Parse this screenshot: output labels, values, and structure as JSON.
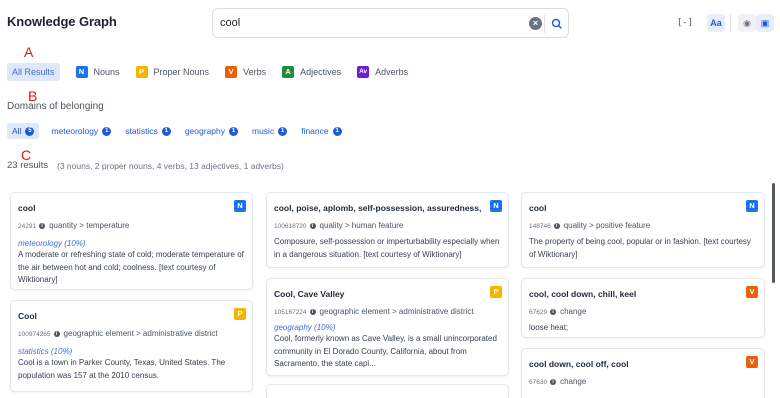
{
  "header": {
    "logo": "Knowledge Graph",
    "search_value": "cool",
    "clear_glyph": "×",
    "font_label": "Aa",
    "expand_glyph": "[-]",
    "settings_glyph": "◉",
    "chat_glyph": "▣"
  },
  "markers": {
    "a": "A",
    "b": "B",
    "c": "C"
  },
  "pos_filters": [
    {
      "label": "All Results"
    },
    {
      "badge": "N",
      "label": "Nouns",
      "color": "#1a73e8"
    },
    {
      "badge": "P",
      "label": "Proper Nouns",
      "color": "#f5b400"
    },
    {
      "badge": "V",
      "label": "Verbs",
      "color": "#e8620c"
    },
    {
      "badge": "A",
      "label": "Adjectives",
      "color": "#1e8e3e"
    },
    {
      "badge": "Av",
      "label": "Adverbs",
      "color": "#6a1fd6"
    }
  ],
  "domains": {
    "title": "Domains of belonging",
    "items": [
      {
        "label": "All",
        "count": "5"
      },
      {
        "label": "meteorology",
        "count": "1"
      },
      {
        "label": "statistics",
        "count": "1"
      },
      {
        "label": "geography",
        "count": "1"
      },
      {
        "label": "music",
        "count": "1"
      },
      {
        "label": "finance",
        "count": "1"
      }
    ]
  },
  "results": {
    "count": "23 results",
    "detail": "(3 nouns, 2 proper nouns, 4 verbs, 13 adjectives, 1 adverbs)"
  },
  "cards": [
    {
      "title": "cool",
      "badge": "N",
      "id": "24291",
      "category": "quantity > temperature",
      "domain": "meteorology (10%)",
      "definition": "A moderate or refreshing state of cold; moderate temperature of the air between hot and cold; coolness. [text courtesy of Wiktionary]"
    },
    {
      "title": "Cool",
      "badge": "P",
      "id": "100974265",
      "category": "geographic element > administrative district",
      "domain": "statistics (10%)",
      "definition": "Cool is a town in Parker County, Texas, United States. The population was 157 at the 2010 census."
    },
    {
      "title": "cool, poise, aplomb, self-possession, assuredness, sa...",
      "badge": "N",
      "id": "100618720",
      "category": "quality > human feature",
      "domain": "",
      "definition": "Composure, self-possession or imperturbability especially when in a dangerous situation. [text courtesy of Wiktionary]"
    },
    {
      "title": "Cool, Cave Valley",
      "badge": "P",
      "id": "105167224",
      "category": "geographic element > administrative district",
      "domain": "geography (10%)",
      "definition": "Cool, formerly known as Cave Valley, is a small unincorporated community in El Dorado County, California, about from Sacramento, the state capi..."
    },
    {
      "title": "cool",
      "badge": "N",
      "id": "148746",
      "category": "quality > positive feature",
      "domain": "",
      "definition": "The property of being cool, popular or in fashion. [text courtesy of Wiktionary]"
    },
    {
      "title": "cool, cool down, chill, keel",
      "badge": "V",
      "id": "67629",
      "category": "change",
      "domain": "",
      "definition": "loose heat;"
    },
    {
      "title": "cool down, cool off, cool",
      "badge": "V",
      "id": "67630",
      "category": "change",
      "domain": "",
      "definition": ""
    }
  ],
  "colors": {
    "noun": "#1a73e8",
    "proper": "#f5b400",
    "verb": "#e8620c",
    "accent": "#1e5bd8"
  }
}
